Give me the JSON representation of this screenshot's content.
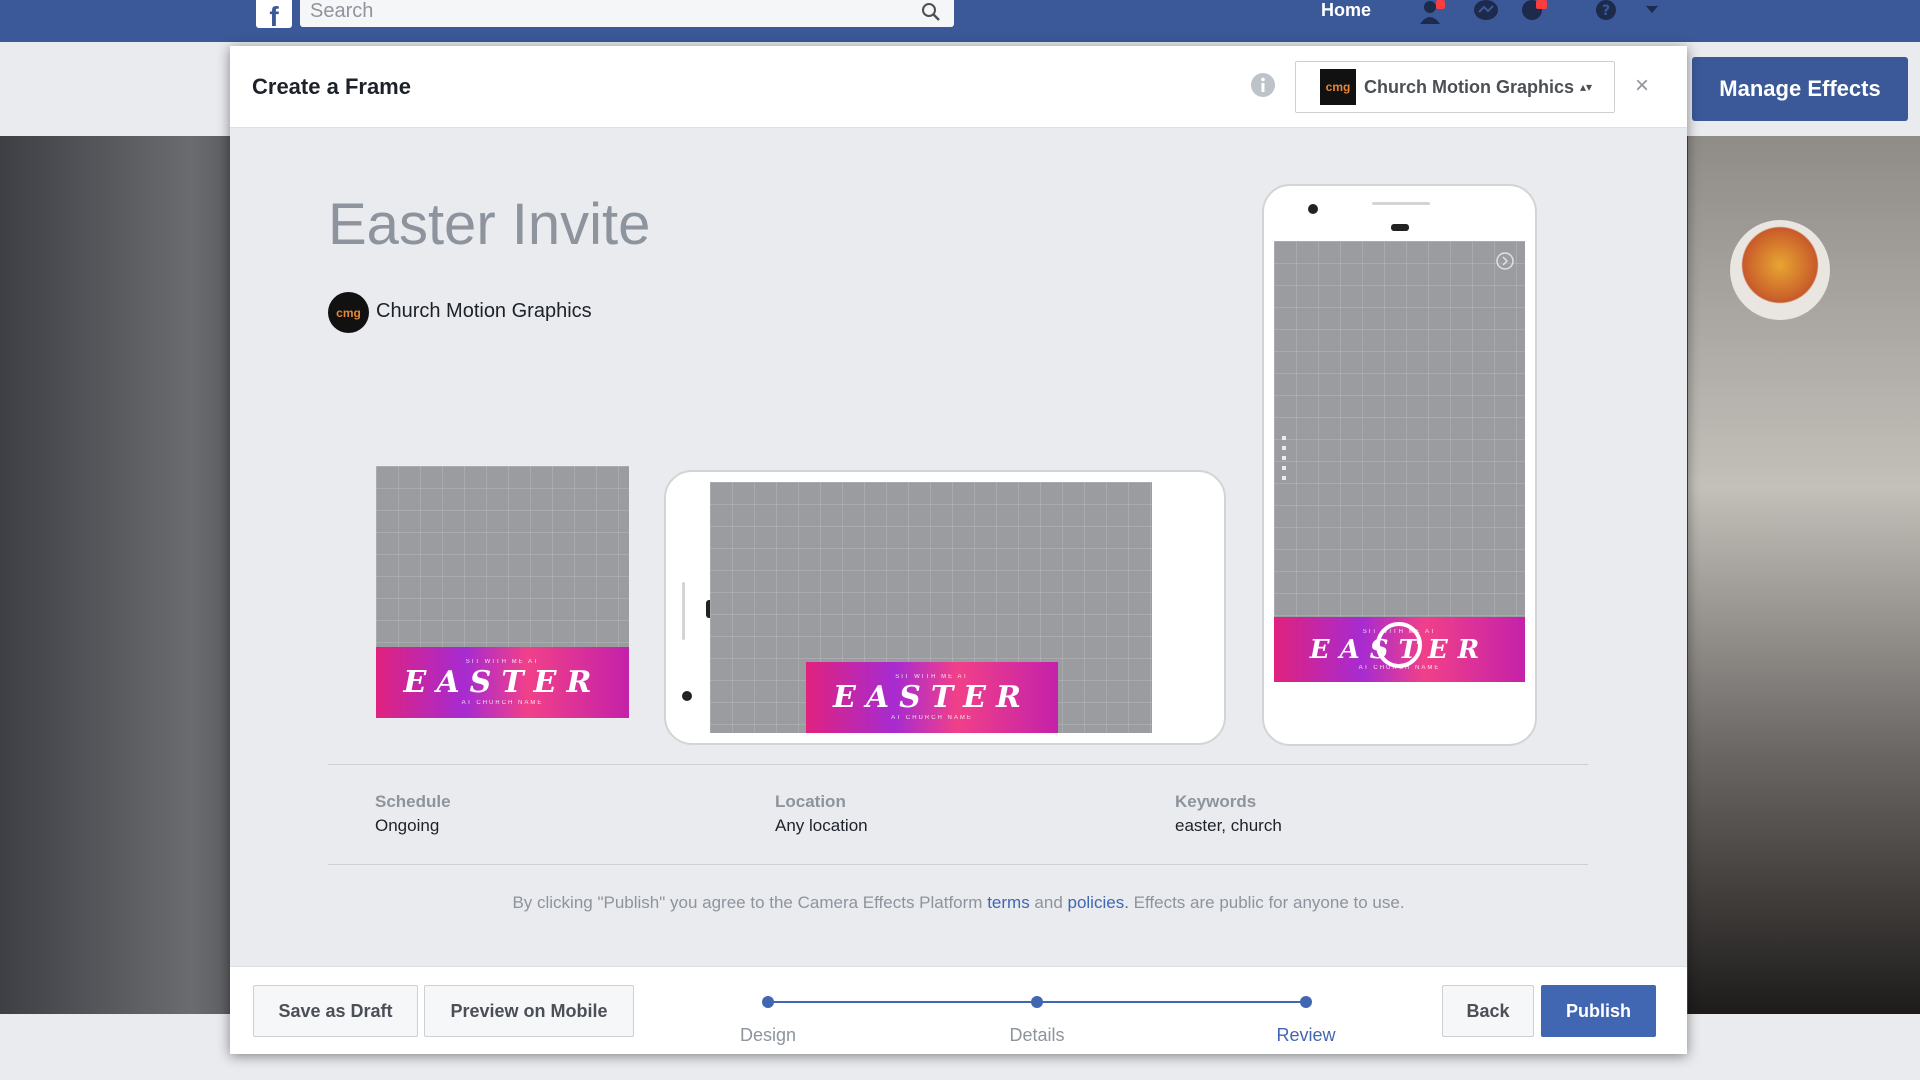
{
  "topbar": {
    "search_placeholder": "Search",
    "home_label": "Home",
    "logo": "f"
  },
  "background": {
    "manage_effects_label": "Manage Effects"
  },
  "modal": {
    "title": "Create a Frame",
    "page_selector": {
      "thumb_text": "cmg",
      "label": "Church Motion Graphics",
      "arrows": "▴▾"
    },
    "close_label": "×",
    "effect_title": "Easter Invite",
    "owner": {
      "avatar_text": "cmg",
      "name": "Church Motion Graphics"
    },
    "banner": {
      "top_text": "SIT WITH ME AT",
      "main_text": "EASTER",
      "bottom_text": "AT CHURCH NAME"
    },
    "meta": [
      {
        "label": "Schedule",
        "value": "Ongoing"
      },
      {
        "label": "Location",
        "value": "Any location"
      },
      {
        "label": "Keywords",
        "value": "easter, church"
      }
    ],
    "terms": {
      "prefix": "By clicking \"Publish\" you agree to the Camera Effects Platform ",
      "terms_link": "terms",
      "middle": " and ",
      "policies_link": "policies.",
      "suffix": " Effects are public for anyone to use."
    },
    "footer": {
      "save_draft": "Save as Draft",
      "preview_mobile": "Preview on Mobile",
      "steps": [
        "Design",
        "Details",
        "Review"
      ],
      "active_step": "Review",
      "back": "Back",
      "publish": "Publish"
    }
  },
  "colors": {
    "facebook_blue": "#3b5998",
    "primary_button": "#4267b2",
    "banner_pink": "#e0227e",
    "banner_purple": "#a62bd1"
  }
}
